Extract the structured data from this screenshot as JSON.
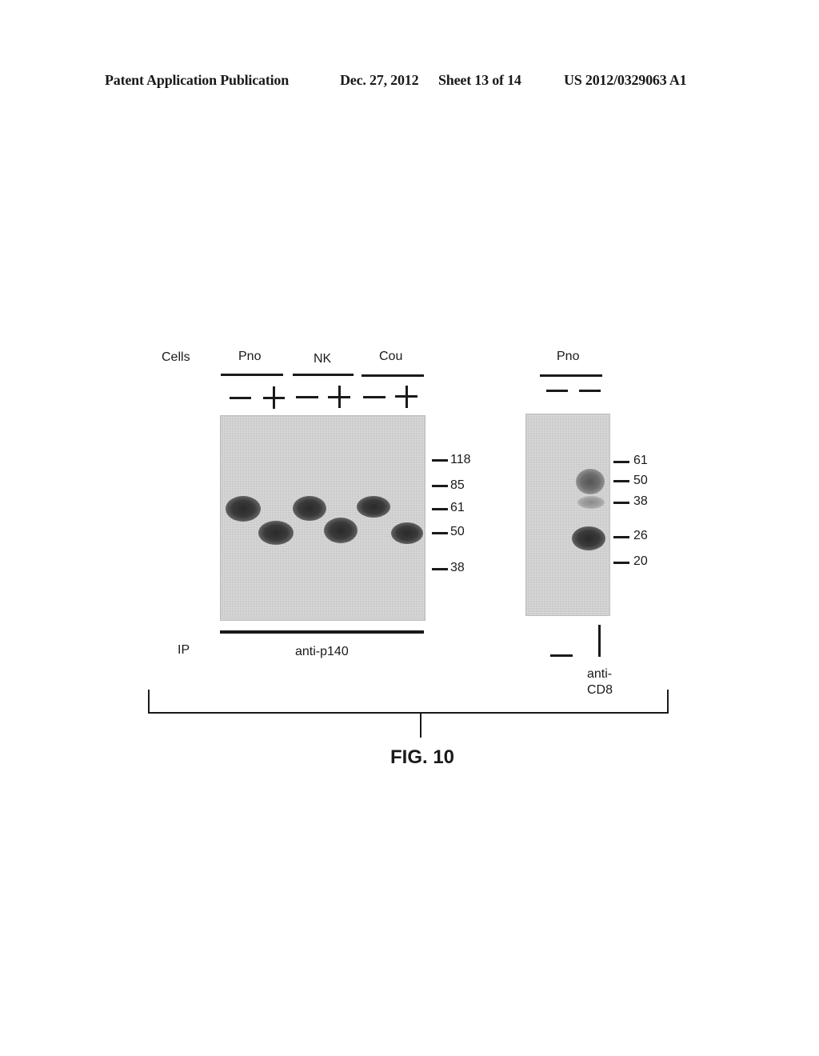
{
  "header": {
    "publication": "Patent Application Publication",
    "date": "Dec. 27, 2012",
    "sheet": "Sheet 13 of 14",
    "number": "US 2012/0329063 A1"
  },
  "figure": {
    "label": "FIG. 10",
    "left_panel": {
      "row_label_cells": "Cells",
      "cell_groups": [
        {
          "name": "Pno",
          "lanes": [
            "−",
            "+"
          ]
        },
        {
          "name": "NK",
          "lanes": [
            "−",
            "+"
          ]
        },
        {
          "name": "Cou",
          "lanes": [
            "−",
            "+"
          ]
        }
      ],
      "row_label_ip": "IP",
      "ip_antibody": "anti-p140",
      "mw_markers": [
        "118",
        "85",
        "61",
        "50",
        "38"
      ],
      "bands": [
        {
          "lane": 1,
          "treatment": "−",
          "approx_mw": "~61",
          "intensity": "strong"
        },
        {
          "lane": 2,
          "treatment": "+",
          "approx_mw": "~50",
          "intensity": "strong"
        },
        {
          "lane": 3,
          "treatment": "−",
          "approx_mw": "~61",
          "intensity": "strong"
        },
        {
          "lane": 4,
          "treatment": "+",
          "approx_mw": "~50",
          "intensity": "strong"
        },
        {
          "lane": 5,
          "treatment": "−",
          "approx_mw": "~61",
          "intensity": "strong"
        },
        {
          "lane": 6,
          "treatment": "+",
          "approx_mw": "~50",
          "intensity": "strong"
        }
      ]
    },
    "right_panel": {
      "cell_group": "Pno",
      "lanes": [
        "−",
        "−"
      ],
      "ip_lanes": [
        "−",
        "|"
      ],
      "ip_antibody_line1": "anti-",
      "ip_antibody_line2": "CD8",
      "mw_markers": [
        "61",
        "50",
        "38",
        "26",
        "20"
      ],
      "bands": [
        {
          "lane": 2,
          "approx_mw": "~50",
          "intensity": "medium"
        },
        {
          "lane": 2,
          "approx_mw": "~38",
          "intensity": "faint"
        },
        {
          "lane": 2,
          "approx_mw": "~26",
          "intensity": "strong"
        }
      ]
    }
  }
}
